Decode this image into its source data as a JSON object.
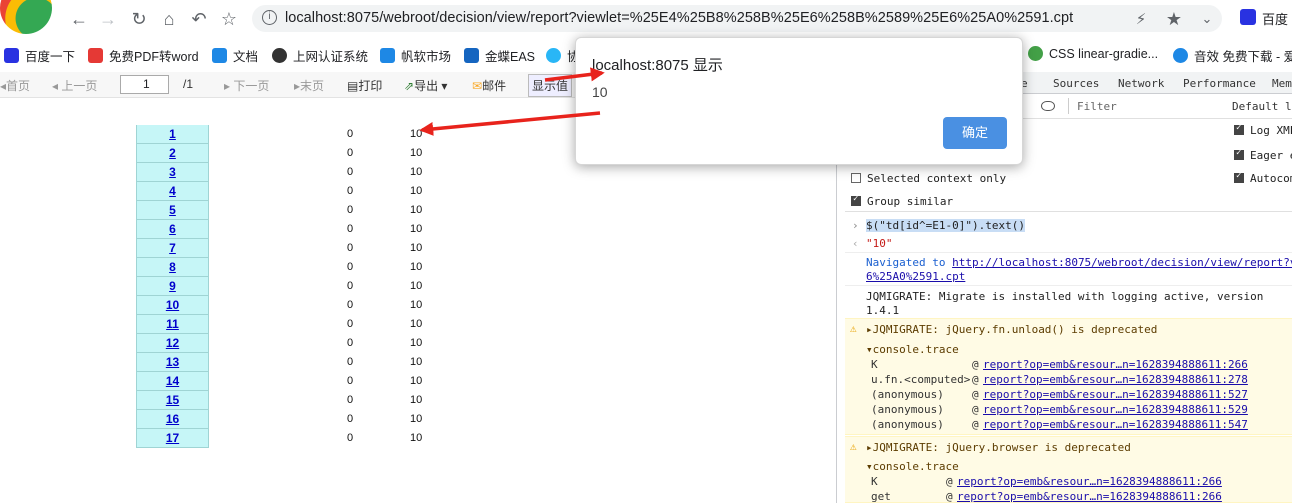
{
  "browser": {
    "url": "localhost:8075/webroot/decision/view/report?viewlet=%25E4%25B8%258B%25E6%258B%2589%25E6%25A0%2591.cpt",
    "brand_partial": "百度"
  },
  "bookmarks": [
    {
      "label": "百度一下",
      "color": "#2932e1"
    },
    {
      "label": "免费PDF转word",
      "color": "#e53935"
    },
    {
      "label": "文档",
      "color": "#1e88e5"
    },
    {
      "label": "上网认证系统",
      "color": "#333333"
    },
    {
      "label": "帆软市场",
      "color": "#1e88e5"
    },
    {
      "label": "金蝶EAS",
      "color": "#1565c0"
    },
    {
      "label": "协",
      "color": "#29b6f6"
    },
    {
      "label": "CSS linear-gradie...",
      "color": "#43a047"
    },
    {
      "label": "音效 免费下载 - 爱",
      "color": "#1e88e5"
    }
  ],
  "report_toolbar": {
    "first": "首页",
    "prev": "上一页",
    "page_value": "1",
    "page_total": "/1",
    "next": "下一页",
    "last": "末页",
    "print": "打印",
    "export": "导出",
    "mail": "邮件",
    "show_value": "显示值"
  },
  "report": {
    "links": [
      "1",
      "2",
      "3",
      "4",
      "5",
      "6",
      "7",
      "8",
      "9",
      "10",
      "11",
      "12",
      "13",
      "14",
      "15",
      "16",
      "17"
    ],
    "col2": "0",
    "col3": "10"
  },
  "devtools": {
    "tabs": [
      "Sources",
      "Network",
      "Performance",
      "Mem"
    ],
    "partial_tab": "e",
    "filter_placeholder": "Filter",
    "levels": "Default le",
    "options_left": [
      "Selected context only",
      "Group similar"
    ],
    "options_right": [
      "Log XMLH",
      "Eager e",
      "Autocomp"
    ],
    "command": "$(\"td[id^=E1-0]\").text()",
    "result": "\"10\"",
    "navigated_label": "Navigated to",
    "navigated_url": "http://localhost:8075/webroot/decision/view/report?v",
    "navigated_url_cont": "6%25A0%2591.cpt",
    "jqmigrate_line1": "JQMIGRATE: Migrate is installed with logging active, version",
    "jqmigrate_line2": "1.4.1",
    "warning1": "JQMIGRATE: jQuery.fn.unload() is deprecated",
    "trace_label": "console.trace",
    "trace1": [
      {
        "fn": "K",
        "src": "report?op=emb&resour…n=1628394888611:266"
      },
      {
        "fn": "u.fn.<computed>",
        "src": "report?op=emb&resour…n=1628394888611:278"
      },
      {
        "fn": "(anonymous)",
        "src": "report?op=emb&resour…n=1628394888611:527"
      },
      {
        "fn": "(anonymous)",
        "src": "report?op=emb&resour…n=1628394888611:529"
      },
      {
        "fn": "(anonymous)",
        "src": "report?op=emb&resour…n=1628394888611:547"
      }
    ],
    "warning2": "JQMIGRATE: jQuery.browser is deprecated",
    "trace2": [
      {
        "fn": "K",
        "src": "report?op=emb&resour…n=1628394888611:266"
      },
      {
        "fn": "get",
        "src": "report?op=emb&resour…n=1628394888611:266"
      }
    ]
  },
  "dialog": {
    "title": "localhost:8075 显示",
    "message": "10",
    "ok": "确定"
  },
  "colors": {
    "cell_bg": "#c6f6f7",
    "link": "#0000cc",
    "dialog_button": "#4a90e2",
    "annotation_arrow": "#e8231c",
    "warning_bg": "#fffbe5"
  }
}
